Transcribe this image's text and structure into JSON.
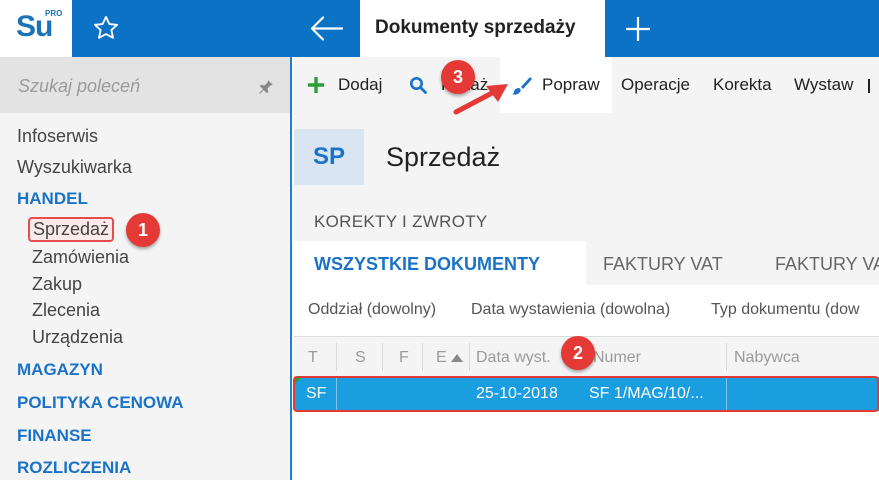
{
  "brand": {
    "logo_text": "Su",
    "logo_sup": "PRO"
  },
  "sidebar": {
    "search_placeholder": "Szukaj poleceń",
    "items": [
      {
        "label": "Infoserwis"
      },
      {
        "label": "Wyszukiwarka"
      }
    ],
    "sections": [
      {
        "label": "HANDEL"
      },
      {
        "label": "MAGAZYN"
      },
      {
        "label": "POLITYKA CENOWA"
      },
      {
        "label": "FINANSE"
      },
      {
        "label": "ROZLICZENIA"
      }
    ],
    "handel_items": [
      {
        "label": "Sprzedaż"
      },
      {
        "label": "Zamówienia"
      },
      {
        "label": "Zakup"
      },
      {
        "label": "Zlecenia"
      },
      {
        "label": "Urządzenia"
      }
    ]
  },
  "tabs": {
    "active_document": "Dokumenty sprzedaży"
  },
  "toolbar": {
    "add": "Dodaj",
    "show": "Pokaż",
    "edit": "Popraw",
    "operations": "Operacje",
    "correction": "Korekta",
    "issue": "Wystaw"
  },
  "main": {
    "badge": "SP",
    "title": "Sprzedaż",
    "group_label": "KOREKTY I ZWROTY",
    "view_tabs": [
      "WSZYSTKIE DOKUMENTY",
      "FAKTURY VAT",
      "FAKTURY VA"
    ],
    "filters": [
      "Oddział (dowolny)",
      "Data wystawienia (dowolna)",
      "Typ dokumentu (dow"
    ]
  },
  "grid": {
    "columns": [
      "T",
      "S",
      "F",
      "E",
      "Data wyst.",
      "Numer",
      "Nabywca"
    ],
    "rows": [
      {
        "T": "SF",
        "date": "25-10-2018",
        "number": "SF 1/MAG/10/..."
      }
    ]
  },
  "annotations": {
    "step1": "1",
    "step2": "2",
    "step3": "3"
  },
  "colors": {
    "accent": "#0b72c6",
    "selection": "#1a9ee0",
    "section": "#1a73c8",
    "marker": "#e53935",
    "add_icon": "#2e9e3b"
  }
}
